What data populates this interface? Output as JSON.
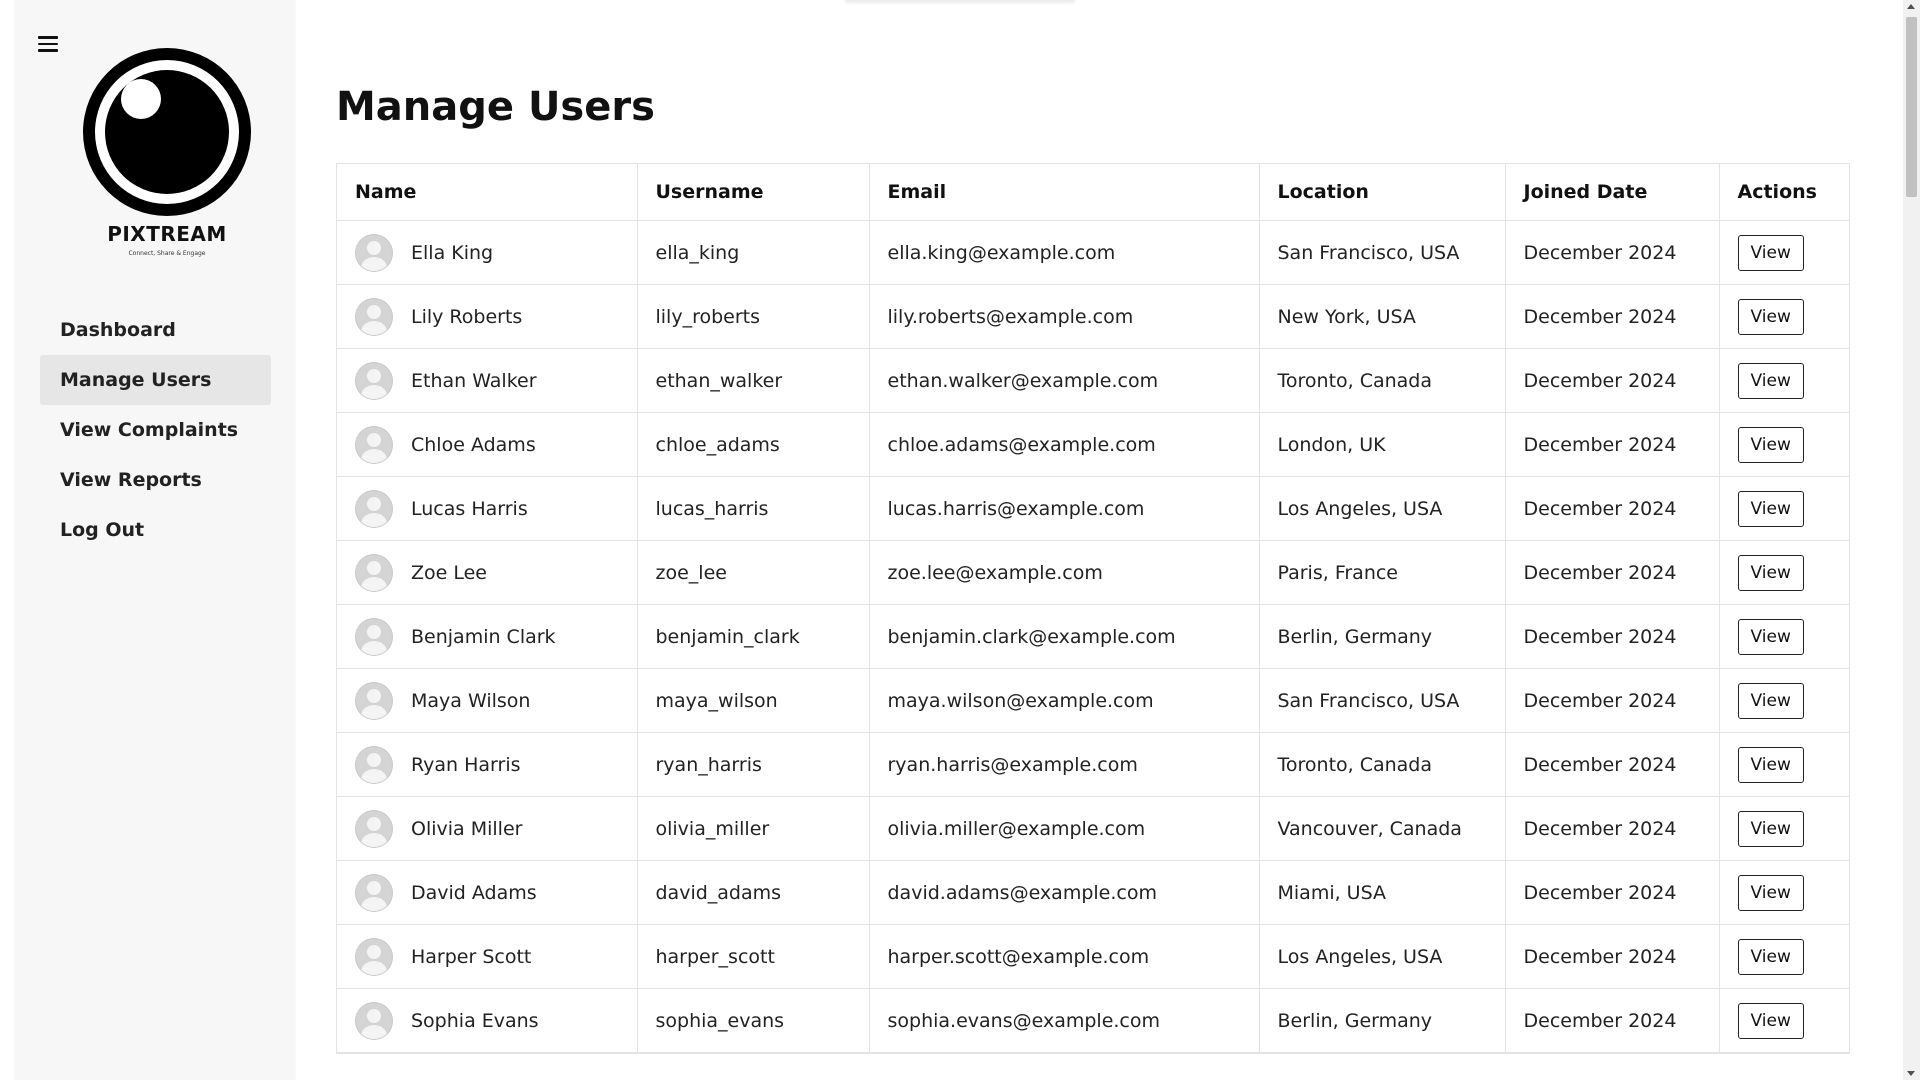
{
  "app": {
    "brand_name": "PIXTREAM",
    "brand_tagline": "Connect, Share & Engage"
  },
  "sidebar": {
    "menu_icon": "hamburger-icon",
    "items": [
      {
        "label": "Dashboard",
        "active": false
      },
      {
        "label": "Manage Users",
        "active": true
      },
      {
        "label": "View Complaints",
        "active": false
      },
      {
        "label": "View Reports",
        "active": false
      },
      {
        "label": "Log Out",
        "active": false
      }
    ]
  },
  "main": {
    "title": "Manage Users",
    "table": {
      "columns": [
        "Name",
        "Username",
        "Email",
        "Location",
        "Joined Date",
        "Actions"
      ],
      "action_label": "View",
      "rows": [
        {
          "name": "Ella King",
          "username": "ella_king",
          "email": "ella.king@example.com",
          "location": "San Francisco, USA",
          "joined": "December 2024"
        },
        {
          "name": "Lily Roberts",
          "username": "lily_roberts",
          "email": "lily.roberts@example.com",
          "location": "New York, USA",
          "joined": "December 2024"
        },
        {
          "name": "Ethan Walker",
          "username": "ethan_walker",
          "email": "ethan.walker@example.com",
          "location": "Toronto, Canada",
          "joined": "December 2024"
        },
        {
          "name": "Chloe Adams",
          "username": "chloe_adams",
          "email": "chloe.adams@example.com",
          "location": "London, UK",
          "joined": "December 2024"
        },
        {
          "name": "Lucas Harris",
          "username": "lucas_harris",
          "email": "lucas.harris@example.com",
          "location": "Los Angeles, USA",
          "joined": "December 2024"
        },
        {
          "name": "Zoe Lee",
          "username": "zoe_lee",
          "email": "zoe.lee@example.com",
          "location": "Paris, France",
          "joined": "December 2024"
        },
        {
          "name": "Benjamin Clark",
          "username": "benjamin_clark",
          "email": "benjamin.clark@example.com",
          "location": "Berlin, Germany",
          "joined": "December 2024"
        },
        {
          "name": "Maya Wilson",
          "username": "maya_wilson",
          "email": "maya.wilson@example.com",
          "location": "San Francisco, USA",
          "joined": "December 2024"
        },
        {
          "name": "Ryan Harris",
          "username": "ryan_harris",
          "email": "ryan.harris@example.com",
          "location": "Toronto, Canada",
          "joined": "December 2024"
        },
        {
          "name": "Olivia Miller",
          "username": "olivia_miller",
          "email": "olivia.miller@example.com",
          "location": "Vancouver, Canada",
          "joined": "December 2024"
        },
        {
          "name": "David Adams",
          "username": "david_adams",
          "email": "david.adams@example.com",
          "location": "Miami, USA",
          "joined": "December 2024"
        },
        {
          "name": "Harper Scott",
          "username": "harper_scott",
          "email": "harper.scott@example.com",
          "location": "Los Angeles, USA",
          "joined": "December 2024"
        },
        {
          "name": "Sophia Evans",
          "username": "sophia_evans",
          "email": "sophia.evans@example.com",
          "location": "Berlin, Germany",
          "joined": "December 2024"
        }
      ]
    }
  },
  "colors": {
    "sidebar_bg": "#f7f7f8",
    "active_item_bg": "#e6e6e7",
    "border": "#e3e3e3"
  }
}
